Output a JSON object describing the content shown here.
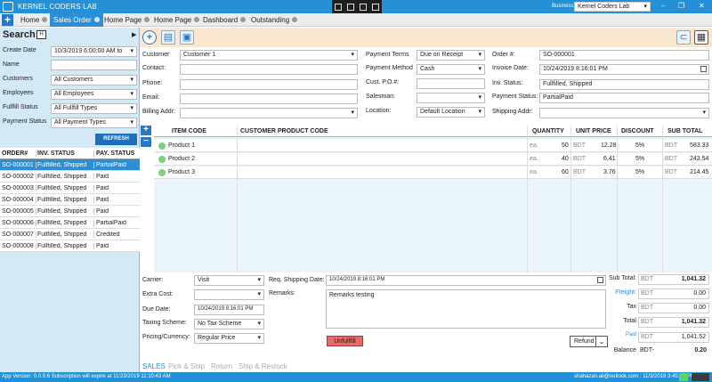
{
  "app": {
    "title": "KERNEL CODERS LAB",
    "business_label": "Business:",
    "business_value": "Kernel Coders Lab"
  },
  "tabs": [
    {
      "label": "Home"
    },
    {
      "label": "Sales Order"
    },
    {
      "label": "Home Page"
    },
    {
      "label": "Home Page"
    },
    {
      "label": "Dashboard"
    },
    {
      "label": "Outstanding"
    }
  ],
  "search": {
    "title": "Search:",
    "create_date_label": "Create Date",
    "create_date_value": "10/3/2019 6:00:00 AM to",
    "name_label": "Name",
    "name_value": "",
    "customers_label": "Customers",
    "customers_value": "All Customers",
    "employees_label": "Employees",
    "employees_value": "All Employees",
    "fulfill_label": "Fullfill Status",
    "fulfill_value": "All Fullfill Types",
    "payment_label": "Payment Status",
    "payment_value": "All Payment Types",
    "refresh_label": "REFRESH"
  },
  "orders": {
    "headers": [
      "ORDER#",
      "INV. STATUS",
      "PAY. STATUS"
    ],
    "rows": [
      [
        "SO-000001",
        "Fullfilled, Shipped",
        "PartialPaid"
      ],
      [
        "SO-000002",
        "Fullfilled, Shipped",
        "Paid"
      ],
      [
        "SO-000003",
        "Fullfilled, Shipped",
        "Paid"
      ],
      [
        "SO-000004",
        "Fullfilled, Shipped",
        "Paid"
      ],
      [
        "SO-000005",
        "Fullfilled, Shipped",
        "Paid"
      ],
      [
        "SO-000006",
        "Fullfilled, Shipped",
        "PartialPaid"
      ],
      [
        "SO-000007",
        "Fullfilled, Shipped",
        "Credited"
      ],
      [
        "SO-000008",
        "Fullfilled, Shipped",
        "Paid"
      ]
    ]
  },
  "form": {
    "customer_label": "Customer",
    "customer_value": "Customer 1",
    "contact_label": "Contact:",
    "phone_label": "Phone:",
    "email_label": "Email:",
    "billing_label": "Billing Addr:",
    "terms_label": "Payment Terms",
    "terms_value": "Due on Receipt",
    "method_label": "Payment Method",
    "method_value": "Cash",
    "po_label": "Cust. P.O.#:",
    "salesman_label": "Salesman:",
    "location_label": "Location:",
    "location_value": "Default Location",
    "order_no_label": "Order #:",
    "order_no_value": "SO-000001",
    "invoice_date_label": "Invoice Date:",
    "invoice_date_value": "10/24/2019 8:16:01 PM",
    "inv_status_label": "Inv. Status:",
    "inv_status_value": "Fullfilled, Shipped",
    "pay_status_label": "Payment Status:",
    "pay_status_value": "PartialPaid",
    "shipping_label": "Shipping Addr:"
  },
  "items": {
    "headers": [
      "ITEM CODE",
      "CUSTOMER PRODUCT CODE",
      "QUANTITY",
      "UNIT PRICE",
      "DISCOUNT",
      "SUB TOTAL"
    ],
    "rows": [
      {
        "code": "Product 1",
        "unit": "ea.",
        "qty": "50",
        "cur": "BDT",
        "price": "12.28",
        "disc": "5%",
        "cur2": "BDT",
        "total": "583.33"
      },
      {
        "code": "Product 2",
        "unit": "ea.",
        "qty": "40",
        "cur": "BDT",
        "price": "6.41",
        "disc": "5%",
        "cur2": "BDT",
        "total": "243.54"
      },
      {
        "code": "Product 3",
        "unit": "ea.",
        "qty": "60",
        "cur": "BDT",
        "price": "3.76",
        "disc": "5%",
        "cur2": "BDT",
        "total": "214.45"
      }
    ]
  },
  "bottom": {
    "carrier_label": "Carrier:",
    "carrier_value": "Visit",
    "extra_label": "Extra Cost:",
    "due_label": "Due Date:",
    "due_value": "10/24/2019 8:16:01 PM",
    "tax_label": "Taxing Scheme:",
    "tax_value": "No Tax Scheme",
    "pricing_label": "Pricing/Currency:",
    "pricing_value": "Regular Price",
    "req_ship_label": "Req. Shipping Date:",
    "req_ship_value": "10/24/2019 8:16:01 PM",
    "remarks_label": "Remarks:",
    "remarks_value": "Remarks testing",
    "unfulfill_label": "Unfullfill",
    "refund_label": "Refund"
  },
  "totals": {
    "subtotal_label": "Sub Total:",
    "subtotal_cur": "BDT",
    "subtotal": "1,041.32",
    "freight_label": "Freight:",
    "freight_cur": "BDT",
    "freight": "0.00",
    "tax_label": "Tax",
    "tax_cur": "BDT",
    "tax": "0.00",
    "total_label": "Total",
    "total_cur": "BDT",
    "total": "1,041.32",
    "paid_label": "Paid",
    "paid_cur": "BDT",
    "paid": "1,041.52",
    "balance_label": "Balance",
    "balance_cur": "BDT-",
    "balance": "0.20"
  },
  "bottom_tabs": [
    "SALES",
    "Pick & Ship",
    "Return",
    "Ship & Restock"
  ],
  "statusbar": {
    "left": "App Version: 0.0.0.6   Subscription will expire at 11/23/2019 11:10:43 AM",
    "right": "shahazan.ali@outlook.com : 11/3/2019 3:45:47 PM"
  }
}
